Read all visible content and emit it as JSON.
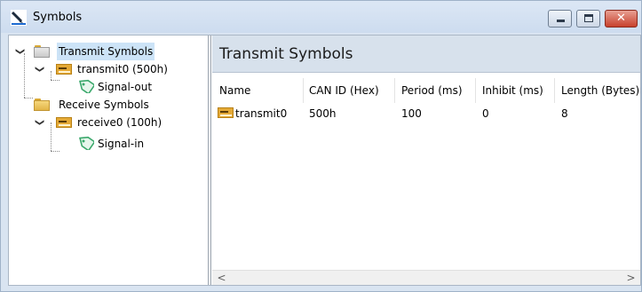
{
  "window": {
    "title": "Symbols",
    "controls": {
      "close_glyph": "✕"
    }
  },
  "tree": {
    "transmit_label": "Transmit Symbols",
    "transmit_message": "transmit0 (500h)",
    "transmit_signal": "Signal-out",
    "receive_label": "Receive Symbols",
    "receive_message": "receive0 (100h)",
    "receive_signal": "Signal-in",
    "chevron": "❯"
  },
  "detail": {
    "title": "Transmit Symbols",
    "columns": [
      "Name",
      "CAN ID (Hex)",
      "Period (ms)",
      "Inhibit (ms)",
      "Length (Bytes)"
    ],
    "rows": [
      {
        "name": "transmit0",
        "can_id": "500h",
        "period": "100",
        "inhibit": "0",
        "length": "8"
      }
    ]
  },
  "scrollbar": {
    "left_arrow": "<",
    "right_arrow": ">"
  },
  "colors": {
    "titlebar": "#cddcef",
    "selection": "#cce3f7",
    "header_band": "#d7e1ec",
    "close_button": "#c8412c",
    "tag_green": "#3aa86b"
  },
  "icons": {
    "app": "pen-icon",
    "folder": "folder-icon",
    "message": "can-message-icon",
    "signal": "tag-icon"
  }
}
